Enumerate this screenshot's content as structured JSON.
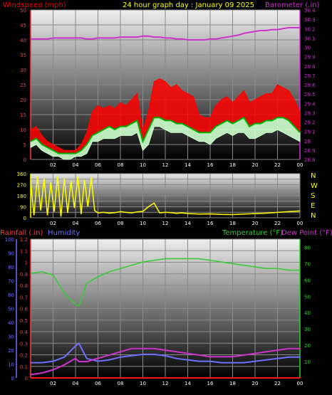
{
  "header": {
    "left": "Windspeed (mph)",
    "title": "24 hour graph day : January 09 2025",
    "right": "Barometer (.in)"
  },
  "colors": {
    "background": "#000000",
    "wind_label": "#ff0000",
    "title": "#ffff00",
    "baro_label": "#cc33cc",
    "wind_axis": "#ff3b3b",
    "baro_axis": "#cc33cc",
    "gust": "#ff0000",
    "avg_wind": "#00b300",
    "wind_range": "#ccffcc",
    "direction": "#ffff00",
    "rain": "#ff1a1a",
    "humidity": "#7070ff",
    "temperature": "#33cc33",
    "dew_point": "#cc33cc",
    "rain_axis": "#ff3b3b",
    "hum_axis": "#7070ff",
    "temp_axis": "#33cc33"
  },
  "compass": [
    "N",
    "W",
    "S",
    "E",
    "N"
  ],
  "bottom_header": {
    "rain": "Rainfall (.in)",
    "humidity": "Humidity",
    "temperature": "Temperature (°F)",
    "dew": "Dew Point (°F)"
  },
  "chart_data": [
    {
      "type": "line",
      "title": "24 hour graph day : January 09 2025",
      "x_ticks": [
        "02",
        "04",
        "06",
        "08",
        "10",
        "12",
        "14",
        "16",
        "18",
        "20",
        "22",
        "00"
      ],
      "x": [
        0,
        0.5,
        1,
        1.5,
        2,
        2.5,
        3,
        3.5,
        4,
        4.5,
        5,
        5.5,
        6,
        6.5,
        7,
        7.5,
        8,
        8.5,
        9,
        9.5,
        10,
        10.5,
        11,
        11.5,
        12,
        12.5,
        13,
        13.5,
        14,
        14.5,
        15,
        15.5,
        16,
        16.5,
        17,
        17.5,
        18,
        18.5,
        19,
        19.5,
        20,
        20.5,
        21,
        21.5,
        22,
        22.5,
        23,
        23.5,
        24
      ],
      "y_left": {
        "label": "Windspeed (mph)",
        "range": [
          0,
          50
        ],
        "ticks": [
          0,
          5,
          10,
          15,
          20,
          25,
          30,
          35,
          40,
          45,
          50
        ]
      },
      "y_right": {
        "label": "Barometer (.in)",
        "range": [
          28.8,
          30.4
        ],
        "ticks": [
          "28.8",
          "28.9",
          "29",
          "29.1",
          "29.2",
          "29.3",
          "29.4",
          "29.5",
          "29.6",
          "29.7",
          "29.8",
          "29.9",
          "30",
          "30.1",
          "30.2",
          "30.3",
          "30.4"
        ]
      },
      "series": [
        {
          "name": "Windspeed (mph)",
          "axis": "left",
          "values": [
            10,
            11,
            8,
            6,
            5,
            4,
            3,
            3,
            3,
            5,
            9,
            16,
            18,
            17,
            18,
            17,
            19,
            18,
            20,
            22,
            10,
            16,
            26,
            27,
            26,
            24,
            25,
            23,
            22,
            21,
            15,
            14,
            14,
            18,
            20,
            21,
            19,
            21,
            23,
            19,
            20,
            21,
            22,
            22,
            25,
            24,
            23,
            20,
            16
          ]
        },
        {
          "name": "avg",
          "axis": "left",
          "values": [
            6,
            7,
            5,
            4,
            3,
            2,
            2,
            2,
            2,
            3,
            5,
            8,
            9,
            10,
            11,
            10,
            11,
            11,
            12,
            13,
            6,
            10,
            14,
            14,
            13,
            13,
            12,
            12,
            11,
            10,
            9,
            9,
            9,
            11,
            12,
            13,
            12,
            13,
            14,
            11,
            12,
            12,
            13,
            13,
            14,
            14,
            13,
            11,
            9
          ]
        },
        {
          "name": "range",
          "axis": "left",
          "values": [
            4,
            5,
            3,
            2,
            1,
            1,
            0,
            0,
            1,
            1,
            2,
            6,
            6,
            7,
            7,
            7,
            8,
            8,
            8,
            9,
            3,
            5,
            11,
            11,
            10,
            9,
            9,
            9,
            8,
            7,
            6,
            6,
            5,
            7,
            8,
            9,
            8,
            9,
            9,
            7,
            7,
            8,
            9,
            9,
            10,
            9,
            8,
            7,
            6
          ]
        },
        {
          "name": "Barometer (.in)",
          "axis": "right",
          "values": [
            30.09,
            30.09,
            30.09,
            30.09,
            30.1,
            30.1,
            30.1,
            30.1,
            30.1,
            30.1,
            30.09,
            30.09,
            30.1,
            30.1,
            30.1,
            30.1,
            30.11,
            30.11,
            30.11,
            30.11,
            30.12,
            30.12,
            30.11,
            30.11,
            30.1,
            30.1,
            30.09,
            30.09,
            30.08,
            30.08,
            30.08,
            30.08,
            30.09,
            30.09,
            30.1,
            30.11,
            30.12,
            30.13,
            30.15,
            30.16,
            30.17,
            30.18,
            30.18,
            30.19,
            30.19,
            30.2,
            30.21,
            30.21,
            30.21
          ]
        }
      ]
    },
    {
      "type": "line",
      "title": "",
      "x_ticks": [
        "02",
        "04",
        "06",
        "08",
        "10",
        "12",
        "14",
        "16",
        "18",
        "20",
        "22",
        "00"
      ],
      "y_left": {
        "range": [
          0,
          360
        ],
        "ticks": [
          "0",
          "45",
          "90",
          "135",
          "180",
          "225",
          "270",
          "315",
          "360"
        ]
      },
      "series": [
        {
          "name": "direction",
          "points": [
            [
              0,
              300
            ],
            [
              0.3,
              20
            ],
            [
              0.6,
              340
            ],
            [
              0.9,
              60
            ],
            [
              1.2,
              320
            ],
            [
              1.5,
              20
            ],
            [
              1.8,
              290
            ],
            [
              2.1,
              50
            ],
            [
              2.4,
              340
            ],
            [
              2.7,
              10
            ],
            [
              3.0,
              320
            ],
            [
              3.3,
              40
            ],
            [
              3.6,
              300
            ],
            [
              3.9,
              80
            ],
            [
              4.2,
              340
            ],
            [
              4.5,
              30
            ],
            [
              4.8,
              310
            ],
            [
              5.1,
              90
            ],
            [
              5.4,
              330
            ],
            [
              5.7,
              60
            ],
            [
              6.0,
              40
            ],
            [
              6.5,
              45
            ],
            [
              7,
              38
            ],
            [
              7.5,
              42
            ],
            [
              8,
              50
            ],
            [
              8.5,
              44
            ],
            [
              9,
              40
            ],
            [
              9.5,
              48
            ],
            [
              10,
              52
            ],
            [
              10.5,
              90
            ],
            [
              11,
              120
            ],
            [
              11.5,
              40
            ],
            [
              12,
              45
            ],
            [
              12.5,
              42
            ],
            [
              13,
              36
            ],
            [
              13.5,
              40
            ],
            [
              14,
              35
            ],
            [
              15,
              30
            ],
            [
              16,
              32
            ],
            [
              17,
              28
            ],
            [
              18,
              26
            ],
            [
              19,
              30
            ],
            [
              20,
              34
            ],
            [
              21,
              38
            ],
            [
              22,
              44
            ],
            [
              23,
              50
            ],
            [
              24,
              56
            ]
          ]
        }
      ]
    },
    {
      "type": "line",
      "title": "",
      "x_ticks": [
        "02",
        "04",
        "06",
        "08",
        "10",
        "12",
        "14",
        "16",
        "18",
        "20",
        "22",
        "00"
      ],
      "x": [
        0,
        1,
        2,
        3,
        4,
        4.3,
        5,
        6,
        7,
        8,
        9,
        10,
        11,
        12,
        13,
        14,
        15,
        16,
        17,
        18,
        19,
        20,
        21,
        22,
        23,
        24
      ],
      "y_left_outer": {
        "label": "Rainfall (.in)",
        "range": [
          0,
          1.2
        ],
        "ticks": [
          "0",
          "0.1",
          "0.2",
          "0.3",
          "0.4",
          "0.5",
          "0.6",
          "0.7",
          "0.8",
          "0.9",
          "1",
          "1.1",
          "1.2"
        ]
      },
      "y_left_inner": {
        "label": "Humidity",
        "range": [
          0,
          100
        ],
        "ticks": [
          "0",
          "10",
          "20",
          "30",
          "40",
          "50",
          "60",
          "70",
          "80",
          "90",
          "100"
        ]
      },
      "y_right": {
        "label": "Temperature (°F)",
        "range": [
          0,
          85
        ],
        "ticks": [
          "10",
          "20",
          "30",
          "40",
          "50",
          "60",
          "70",
          "80"
        ]
      },
      "series": [
        {
          "name": "Rainfall (.in)",
          "axis": "outer",
          "values": [
            0,
            0,
            0,
            0,
            0,
            0,
            0,
            0,
            0,
            0,
            0,
            0,
            0,
            0,
            0,
            0,
            0,
            0,
            0,
            0,
            0,
            0,
            0,
            0,
            0,
            0
          ]
        },
        {
          "name": "Humidity",
          "axis": "inner",
          "values": [
            11,
            11,
            12,
            15,
            23,
            25,
            14,
            12,
            13,
            15,
            16,
            17,
            17,
            16,
            14,
            13,
            12,
            12,
            11,
            11,
            11,
            12,
            13,
            14,
            15,
            15
          ]
        },
        {
          "name": "Temperature (°F)",
          "axis": "right",
          "values": [
            64,
            65,
            63,
            52,
            45,
            44,
            58,
            62,
            65,
            67,
            69,
            71,
            72,
            73,
            73,
            73,
            73,
            72,
            71,
            70,
            69,
            68,
            67,
            67,
            66,
            66
          ]
        },
        {
          "name": "Dew Point (°F)",
          "axis": "right",
          "values": [
            2,
            3,
            5,
            8,
            12,
            10,
            10,
            12,
            14,
            16,
            18,
            18,
            18,
            17,
            16,
            15,
            14,
            13,
            13,
            13,
            14,
            15,
            16,
            17,
            18,
            18
          ]
        }
      ]
    }
  ]
}
